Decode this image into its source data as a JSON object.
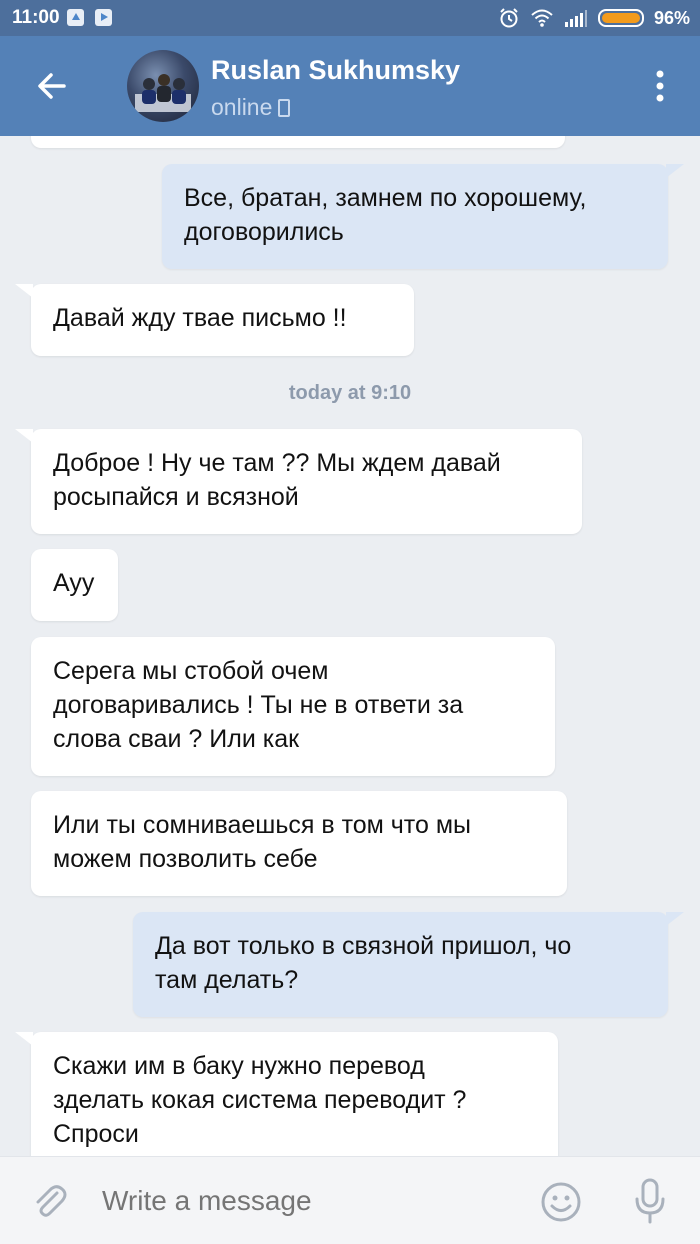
{
  "statusbar": {
    "time": "11:00",
    "battery_percent": "96%",
    "battery_level": 0.96,
    "icons": [
      "upload-notification-icon",
      "play-notification-icon",
      "alarm-icon",
      "wifi-icon",
      "signal-icon",
      "battery-icon"
    ]
  },
  "header": {
    "name": "Ruslan Sukhumsky",
    "status": "online",
    "icons": [
      "back-arrow-icon",
      "phone-icon",
      "more-vertical-icon"
    ]
  },
  "messages": [
    {
      "dir": "out",
      "text": "Все, братан, замнем по хорошему,\nдоговорились"
    },
    {
      "dir": "in",
      "text": "Давай жду твае письмо !!"
    },
    {
      "dir": "in",
      "text": "Доброе ! Ну че там ?? Мы ждем давай\nросыпайся и всязной"
    },
    {
      "dir": "in",
      "text": "Ауу"
    },
    {
      "dir": "in",
      "text": "Серега мы стобой очем\nдоговаривались ! Ты не в ответи за\nслова сваи ? Или как"
    },
    {
      "dir": "in",
      "text": "Или ты сомниваешься в том что мы\nможем позволить себе"
    },
    {
      "dir": "out",
      "text": "Да вот только в связной пришол, чо\nтам делать?"
    },
    {
      "dir": "in",
      "text": "Скажи им в баку нужно перевод\nзделать кокая система переводит ?\nСпроси"
    }
  ],
  "date_separator": "today at 9:10",
  "composer": {
    "placeholder": "Write a message",
    "icons": [
      "paperclip-icon",
      "emoji-icon",
      "microphone-icon"
    ]
  },
  "colors": {
    "header": "#5481b7",
    "statusbar": "#4d6f9c",
    "background": "#ebeef2",
    "incoming_bubble": "#ffffff",
    "outgoing_bubble": "#dbe6f5",
    "battery": "#f39b1c"
  }
}
